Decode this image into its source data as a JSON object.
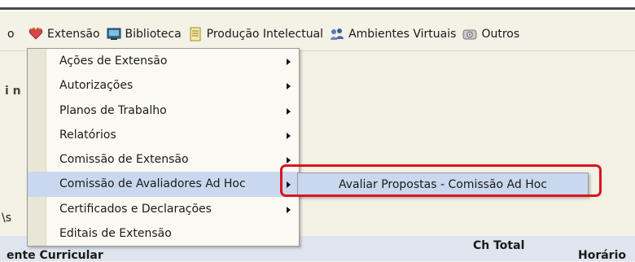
{
  "menubar": {
    "items": [
      {
        "label": "o"
      },
      {
        "label": "Extensão",
        "icon": "heart-icon"
      },
      {
        "label": "Biblioteca",
        "icon": "monitor-icon"
      },
      {
        "label": "Produção Intelectual",
        "icon": "document-icon"
      },
      {
        "label": "Ambientes Virtuais",
        "icon": "people-icon"
      },
      {
        "label": "Outros",
        "icon": "settings-icon"
      }
    ]
  },
  "background": {
    "fragment_1": "i n",
    "fragment_2": "\\s",
    "table_col_left": "ente Curricular",
    "table_col_total": "Ch Total",
    "table_col_horario": "Horário"
  },
  "extensao_menu": {
    "items": [
      {
        "label": "Ações de Extensão",
        "has_submenu": true
      },
      {
        "label": "Autorizações",
        "has_submenu": true
      },
      {
        "label": "Planos de Trabalho",
        "has_submenu": true
      },
      {
        "label": "Relatórios",
        "has_submenu": true
      },
      {
        "label": "Comissão de Extensão",
        "has_submenu": true
      },
      {
        "label": "Comissão de Avaliadores Ad Hoc",
        "has_submenu": true,
        "highlighted": true
      },
      {
        "label": "Certificados e Declarações",
        "has_submenu": true
      },
      {
        "label": "Editais de Extensão",
        "has_submenu": false
      }
    ]
  },
  "submenu": {
    "item": "Avaliar Propostas - Comissão Ad Hoc"
  },
  "colors": {
    "highlight": "#c9d8ee",
    "annotation_red": "#d9161f"
  }
}
